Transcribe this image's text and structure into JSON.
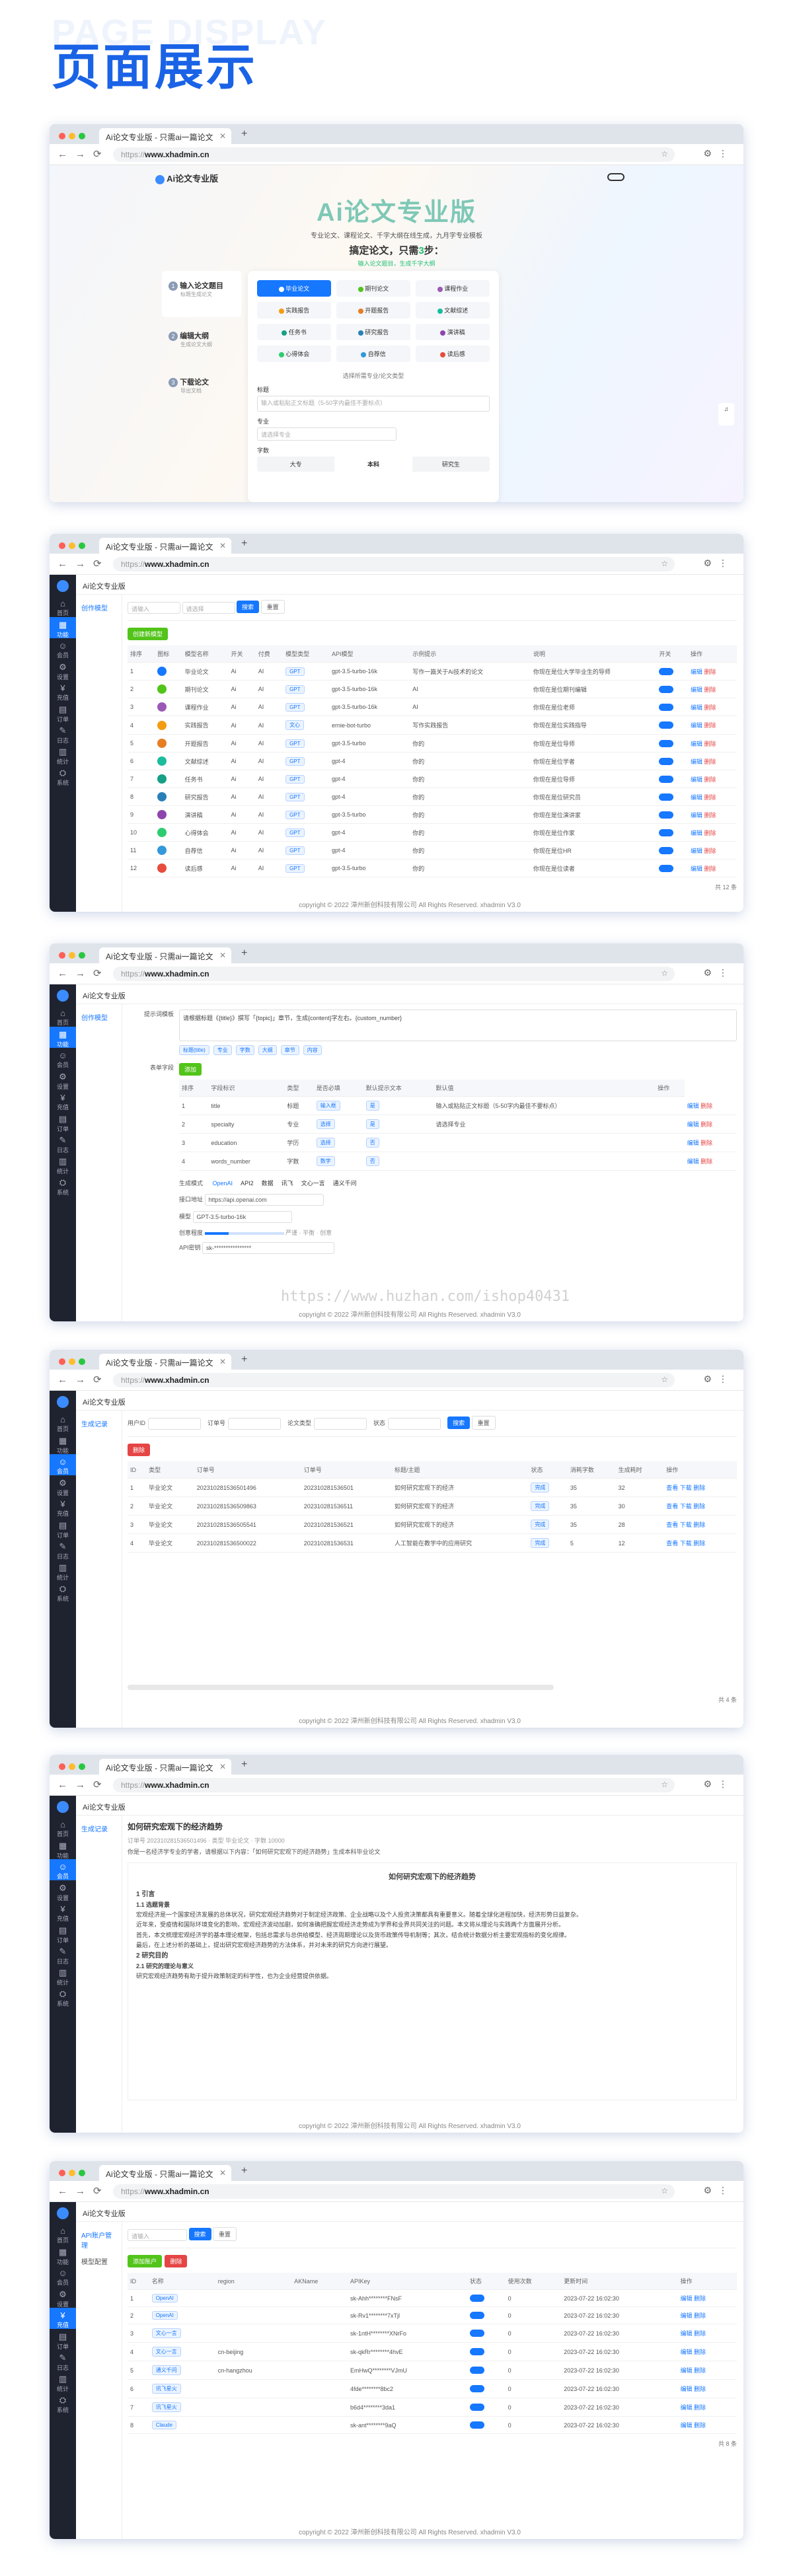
{
  "page": {
    "bg_title": "PAGE DISPLAY",
    "title": "页面展示"
  },
  "browser": {
    "tab_title": "Ai论文专业版 - 只需ai一篇论文",
    "url_prefix": "https://",
    "url_host": "www.xhadmin.cn"
  },
  "footer": "copyright © 2022 漳州新创科技有限公司 All Rights Reserved. xhadmin V3.0",
  "sidebar": {
    "items": [
      "首页",
      "功能",
      "会员",
      "设置",
      "充值",
      "订单",
      "日志",
      "统计",
      "系统"
    ]
  },
  "s1": {
    "brand": "Ai论文专业版",
    "headline": "Ai论文专业版",
    "intro": "专业论文、课程论文、千字大纲在线生成，九月字专业模板",
    "claim_pre": "搞定论文，只需",
    "claim_num": "3",
    "claim_post": "步：",
    "claim_sub": "输入论文题目，生成千字大纲",
    "steps": [
      {
        "n": "1",
        "t": "输入论文题目",
        "s": "标题生成论文"
      },
      {
        "n": "2",
        "t": "编辑大纲",
        "s": "生成论文大纲"
      },
      {
        "n": "3",
        "t": "下载论文",
        "s": "导出文档"
      }
    ],
    "types": [
      "毕业论文",
      "期刊论文",
      "课程作业",
      "实践报告",
      "开题报告",
      "文献综述",
      "任务书",
      "研究报告",
      "演讲稿",
      "心得体会",
      "自荐信",
      "读后感"
    ],
    "field_title": "标题",
    "title_ph": "输入或粘贴正文标题（5-50字内最佳不要标点）",
    "field_major": "专业",
    "major_ph": "请选择专业",
    "field_level": "字数",
    "levels": [
      "大专",
      "本科",
      "研究生"
    ],
    "choose": "选择所需专业/论文类型"
  },
  "s2": {
    "breadcrumb": "Ai论文专业版",
    "menu": "创作模型",
    "add": "创建新模型",
    "search_ph": "请输入",
    "state_ph": "请选择",
    "search": "搜索",
    "reset": "重置",
    "headers": [
      "排序",
      "图标",
      "模型名称",
      "开关",
      "付费",
      "模型类型",
      "API模型",
      "示例提示",
      "说明",
      "开关",
      "操作"
    ],
    "rows": [
      [
        "1",
        "毕业论文",
        "Ai",
        "AI",
        "GPT",
        "gpt-3.5-turbo-16k",
        "写作一篇关于Ai技术的论文",
        "你现在是位大学毕业生的导师"
      ],
      [
        "2",
        "期刊论文",
        "Ai",
        "AI",
        "GPT",
        "gpt-3.5-turbo-16k",
        "AI",
        "你现在是位期刊编辑"
      ],
      [
        "3",
        "课程作业",
        "Ai",
        "AI",
        "GPT",
        "gpt-3.5-turbo-16k",
        "AI",
        "你现在是位老师"
      ],
      [
        "4",
        "实践报告",
        "Ai",
        "AI",
        "文心",
        "ernie-bot-turbo",
        "写作实践报告",
        "你现在是位实践指导"
      ],
      [
        "5",
        "开题报告",
        "Ai",
        "AI",
        "GPT",
        "gpt-3.5-turbo",
        "你的",
        "你现在是位导师"
      ],
      [
        "6",
        "文献综述",
        "Ai",
        "AI",
        "GPT",
        "gpt-4",
        "你的",
        "你现在是位学者"
      ],
      [
        "7",
        "任务书",
        "Ai",
        "AI",
        "GPT",
        "gpt-4",
        "你的",
        "你现在是位导师"
      ],
      [
        "8",
        "研究报告",
        "Ai",
        "AI",
        "GPT",
        "gpt-4",
        "你的",
        "你现在是位研究员"
      ],
      [
        "9",
        "演讲稿",
        "Ai",
        "AI",
        "GPT",
        "gpt-3.5-turbo",
        "你的",
        "你现在是位演讲家"
      ],
      [
        "10",
        "心得体会",
        "Ai",
        "AI",
        "GPT",
        "gpt-4",
        "你的",
        "你现在是位作家"
      ],
      [
        "11",
        "自荐信",
        "Ai",
        "AI",
        "GPT",
        "gpt-4",
        "你的",
        "你现在是位HR"
      ],
      [
        "12",
        "读后感",
        "Ai",
        "AI",
        "GPT",
        "gpt-3.5-turbo",
        "你的",
        "你现在是位读者"
      ]
    ],
    "edit": "编辑",
    "del": "删除",
    "pager": "共 12 条"
  },
  "s3": {
    "label_prompt": "提示词模板",
    "prompt_text": "请根据标题《{title}》撰写「{topic}」章节，生成{content}字左右。{custom_number}",
    "chips": [
      "标题(title)",
      "专业",
      "字数",
      "大纲",
      "章节",
      "内容"
    ],
    "label_fields": "表单字段",
    "add": "添加",
    "headers": [
      "排序",
      "字段标识",
      "类型",
      "是否必填",
      "默认提示文本",
      "默认值",
      "操作"
    ],
    "rows": [
      [
        "title",
        "标题",
        "输入框",
        "是",
        "输入或粘贴正文标题（5-50字内最佳不要标点）"
      ],
      [
        "specialty",
        "专业",
        "选择",
        "是",
        "请选择专业"
      ],
      [
        "education",
        "学历",
        "选择",
        "否",
        ""
      ],
      [
        "words_number",
        "字数",
        "数字",
        "否",
        ""
      ]
    ],
    "label_mode": "生成模式",
    "modes": [
      "OpenAI",
      "API2",
      "数据",
      "讯飞",
      "文心一言",
      "通义千问"
    ],
    "label_url": "接口地址",
    "url_val": "https://api.openai.com",
    "label_model": "模型",
    "model_val": "GPT-3.5-turbo-16k",
    "label_temp": "创意程度",
    "temp_marks": [
      "严谨",
      "平衡",
      "创意"
    ],
    "label_key": "API密钥",
    "key_val": "sk-****************",
    "watermark": "https://www.huzhan.com/ishop40431"
  },
  "s4": {
    "menu": "生成记录",
    "del_btn": "删除",
    "filters": [
      "用户ID",
      "订单号",
      "论文类型",
      "状态"
    ],
    "search": "搜索",
    "reset": "重置",
    "headers": [
      "ID",
      "类型",
      "订单号",
      "订单号",
      "标题/主题",
      "状态",
      "消耗字数",
      "生成耗时",
      "操作"
    ],
    "rows": [
      [
        "1",
        "毕业论文",
        "202310281536501496",
        "202310281536501",
        "如何研究宏观下的经济",
        "完成",
        "35",
        "32"
      ],
      [
        "2",
        "毕业论文",
        "202310281536509863",
        "202310281536511",
        "如何研究宏观下的经济",
        "完成",
        "35",
        "30"
      ],
      [
        "3",
        "毕业论文",
        "202310281536505541",
        "202310281536521",
        "如何研究宏观下的经济",
        "完成",
        "35",
        "28"
      ],
      [
        "4",
        "毕业论文",
        "202310281536500022",
        "202310281536531",
        "人工智能在教学中的应用研究",
        "完成",
        "5",
        "12"
      ]
    ],
    "actions": "查看 下载 删除",
    "pager": "共 4 条"
  },
  "s5": {
    "menu": "生成记录",
    "doc_title": "如何研究宏观下的经济趋势",
    "meta": "订单号 202310281536501496 · 类型 毕业论文 · 字数 10000",
    "prompt": "你是一名经济学专业的学者，请根据以下内容：「如何研究宏观下的经济趋势」生成本科毕业论文",
    "center_title": "如何研究宏观下的经济趋势",
    "h1": "1 引言",
    "h2": "1.1 选题背景",
    "p1": "宏观经济是一个国家经济发展的总体状况，研究宏观经济趋势对于制定经济政策、企业战略以及个人投资决策都具有重要意义。随着全球化进程加快，经济形势日益复杂。",
    "p2": "近年来，受疫情和国际环境变化的影响，宏观经济波动加剧，如何准确把握宏观经济走势成为学界和业界共同关注的问题。本文将从理论与实践两个方面展开分析。",
    "p3": "首先，本文梳理宏观经济学的基本理论框架，包括总需求与总供给模型、经济周期理论以及货币政策传导机制等；其次，结合统计数据分析主要宏观指标的变化规律。",
    "p4": "最后，在上述分析的基础上，提出研究宏观经济趋势的方法体系，并对未来的研究方向进行展望。",
    "h3": "2 研究目的",
    "h4": "2.1 研究的理论与意义",
    "p5": "研究宏观经济趋势有助于提升政策制定的科学性，也为企业经营提供依据。"
  },
  "s6": {
    "menu1": "API账户管理",
    "menu2": "模型配置",
    "search_ph": "请输入",
    "search": "搜索",
    "reset": "重置",
    "add": "添加账户",
    "del": "删除",
    "headers": [
      "ID",
      "名称",
      "region",
      "AKName",
      "APIKey",
      "状态",
      "使用次数",
      "更新时间",
      "操作"
    ],
    "rows": [
      [
        "1",
        "OpenAI",
        "",
        "",
        "sk-Ahh********FNsF",
        "0",
        "2023-07-22 16:02:30"
      ],
      [
        "2",
        "OpenAI",
        "",
        "",
        "sk-Rv1********7xTjl",
        "0",
        "2023-07-22 16:02:30"
      ],
      [
        "3",
        "文心一言",
        "",
        "",
        "sk-1ntH********XNrFo",
        "0",
        "2023-07-22 16:02:30"
      ],
      [
        "4",
        "文心一言",
        "cn-beijing",
        "",
        "sk-qkRr********4hvE",
        "0",
        "2023-07-22 16:02:30"
      ],
      [
        "5",
        "通义千问",
        "cn-hangzhou",
        "",
        "EmHwQ********VJmU",
        "0",
        "2023-07-22 16:02:30"
      ],
      [
        "6",
        "讯飞星火",
        "",
        "",
        "4fde********8bc2",
        "0",
        "2023-07-22 16:02:30"
      ],
      [
        "7",
        "讯飞星火",
        "",
        "",
        "b6d4********3da1",
        "0",
        "2023-07-22 16:02:30"
      ],
      [
        "8",
        "Claude",
        "",
        "",
        "sk-ant********9aQ",
        "0",
        "2023-07-22 16:02:30"
      ]
    ],
    "ops": "编辑 删除",
    "pager": "共 8 条"
  },
  "colors": {
    "primary": "#1677ff",
    "hero": "#1a63e6",
    "sidebar": "#1f2330",
    "danger": "#e54545",
    "success": "#52c41a"
  }
}
